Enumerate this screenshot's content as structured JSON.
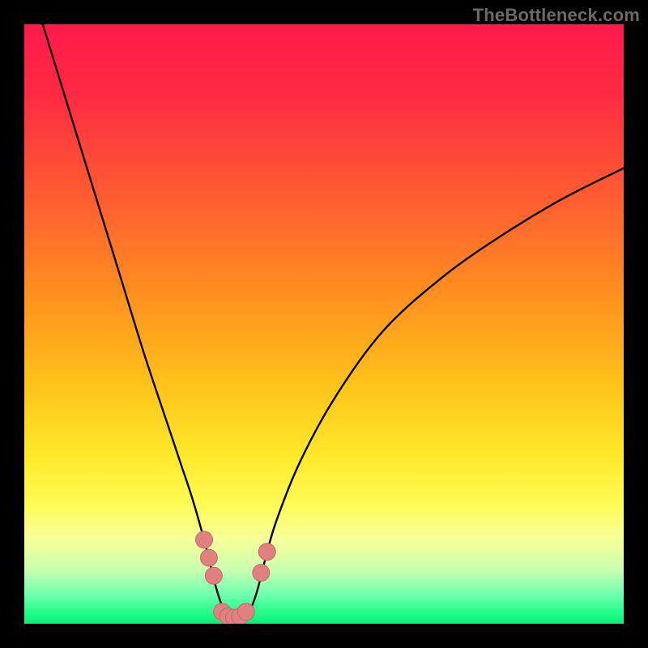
{
  "watermark": "TheBottleneck.com",
  "colors": {
    "frame": "#000000",
    "gradient_stops": [
      {
        "offset": 0.0,
        "color": "#ff1a4b"
      },
      {
        "offset": 0.12,
        "color": "#ff2b42"
      },
      {
        "offset": 0.28,
        "color": "#ff5a32"
      },
      {
        "offset": 0.45,
        "color": "#ff8f20"
      },
      {
        "offset": 0.6,
        "color": "#ffc21a"
      },
      {
        "offset": 0.72,
        "color": "#ffe92a"
      },
      {
        "offset": 0.8,
        "color": "#fffb55"
      },
      {
        "offset": 0.86,
        "color": "#f6ff9a"
      },
      {
        "offset": 0.91,
        "color": "#c9ffb0"
      },
      {
        "offset": 0.95,
        "color": "#73ffb0"
      },
      {
        "offset": 0.985,
        "color": "#1afc84"
      },
      {
        "offset": 1.0,
        "color": "#14e87a"
      }
    ],
    "curve": "#000000",
    "marker_fill": "#e08080",
    "marker_stroke": "#c86a6a"
  },
  "chart_data": {
    "type": "line",
    "title": "",
    "xlabel": "",
    "ylabel": "",
    "xlim": [
      0,
      100
    ],
    "ylim": [
      0,
      100
    ],
    "series": [
      {
        "name": "bottleneck-curve",
        "x": [
          0,
          4,
          8,
          12,
          16,
          20,
          24,
          26,
          28,
          30,
          31,
          32,
          33,
          34,
          35,
          36,
          37,
          38,
          39,
          40,
          42,
          46,
          52,
          60,
          70,
          80,
          90,
          100
        ],
        "y": [
          110,
          97,
          84,
          71,
          58,
          45,
          33,
          27,
          21,
          14,
          10,
          6,
          3,
          1.5,
          1,
          1,
          1.5,
          3,
          6,
          10,
          17,
          27,
          38,
          49,
          58,
          65,
          71,
          76
        ]
      }
    ],
    "markers": {
      "name": "highlighted-points",
      "points": [
        {
          "x": 30.0,
          "y": 14.0
        },
        {
          "x": 30.8,
          "y": 11.0
        },
        {
          "x": 31.6,
          "y": 8.0
        },
        {
          "x": 33.0,
          "y": 2.0
        },
        {
          "x": 34.0,
          "y": 1.2
        },
        {
          "x": 35.0,
          "y": 1.0
        },
        {
          "x": 36.0,
          "y": 1.2
        },
        {
          "x": 37.0,
          "y": 2.0
        },
        {
          "x": 39.5,
          "y": 8.5
        },
        {
          "x": 40.5,
          "y": 12.0
        }
      ]
    },
    "notes": "x and y are in percent of plot area (0–100). y increases upward. Curve clipped at top when y > 100."
  }
}
